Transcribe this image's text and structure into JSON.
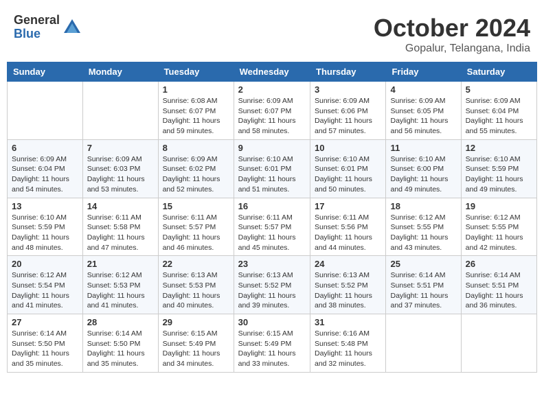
{
  "logo": {
    "general": "General",
    "blue": "Blue"
  },
  "header": {
    "month": "October 2024",
    "location": "Gopalur, Telangana, India"
  },
  "weekdays": [
    "Sunday",
    "Monday",
    "Tuesday",
    "Wednesday",
    "Thursday",
    "Friday",
    "Saturday"
  ],
  "weeks": [
    [
      {
        "day": "",
        "sunrise": "",
        "sunset": "",
        "daylight": ""
      },
      {
        "day": "",
        "sunrise": "",
        "sunset": "",
        "daylight": ""
      },
      {
        "day": "1",
        "sunrise": "Sunrise: 6:08 AM",
        "sunset": "Sunset: 6:07 PM",
        "daylight": "Daylight: 11 hours and 59 minutes."
      },
      {
        "day": "2",
        "sunrise": "Sunrise: 6:09 AM",
        "sunset": "Sunset: 6:07 PM",
        "daylight": "Daylight: 11 hours and 58 minutes."
      },
      {
        "day": "3",
        "sunrise": "Sunrise: 6:09 AM",
        "sunset": "Sunset: 6:06 PM",
        "daylight": "Daylight: 11 hours and 57 minutes."
      },
      {
        "day": "4",
        "sunrise": "Sunrise: 6:09 AM",
        "sunset": "Sunset: 6:05 PM",
        "daylight": "Daylight: 11 hours and 56 minutes."
      },
      {
        "day": "5",
        "sunrise": "Sunrise: 6:09 AM",
        "sunset": "Sunset: 6:04 PM",
        "daylight": "Daylight: 11 hours and 55 minutes."
      }
    ],
    [
      {
        "day": "6",
        "sunrise": "Sunrise: 6:09 AM",
        "sunset": "Sunset: 6:04 PM",
        "daylight": "Daylight: 11 hours and 54 minutes."
      },
      {
        "day": "7",
        "sunrise": "Sunrise: 6:09 AM",
        "sunset": "Sunset: 6:03 PM",
        "daylight": "Daylight: 11 hours and 53 minutes."
      },
      {
        "day": "8",
        "sunrise": "Sunrise: 6:09 AM",
        "sunset": "Sunset: 6:02 PM",
        "daylight": "Daylight: 11 hours and 52 minutes."
      },
      {
        "day": "9",
        "sunrise": "Sunrise: 6:10 AM",
        "sunset": "Sunset: 6:01 PM",
        "daylight": "Daylight: 11 hours and 51 minutes."
      },
      {
        "day": "10",
        "sunrise": "Sunrise: 6:10 AM",
        "sunset": "Sunset: 6:01 PM",
        "daylight": "Daylight: 11 hours and 50 minutes."
      },
      {
        "day": "11",
        "sunrise": "Sunrise: 6:10 AM",
        "sunset": "Sunset: 6:00 PM",
        "daylight": "Daylight: 11 hours and 49 minutes."
      },
      {
        "day": "12",
        "sunrise": "Sunrise: 6:10 AM",
        "sunset": "Sunset: 5:59 PM",
        "daylight": "Daylight: 11 hours and 49 minutes."
      }
    ],
    [
      {
        "day": "13",
        "sunrise": "Sunrise: 6:10 AM",
        "sunset": "Sunset: 5:59 PM",
        "daylight": "Daylight: 11 hours and 48 minutes."
      },
      {
        "day": "14",
        "sunrise": "Sunrise: 6:11 AM",
        "sunset": "Sunset: 5:58 PM",
        "daylight": "Daylight: 11 hours and 47 minutes."
      },
      {
        "day": "15",
        "sunrise": "Sunrise: 6:11 AM",
        "sunset": "Sunset: 5:57 PM",
        "daylight": "Daylight: 11 hours and 46 minutes."
      },
      {
        "day": "16",
        "sunrise": "Sunrise: 6:11 AM",
        "sunset": "Sunset: 5:57 PM",
        "daylight": "Daylight: 11 hours and 45 minutes."
      },
      {
        "day": "17",
        "sunrise": "Sunrise: 6:11 AM",
        "sunset": "Sunset: 5:56 PM",
        "daylight": "Daylight: 11 hours and 44 minutes."
      },
      {
        "day": "18",
        "sunrise": "Sunrise: 6:12 AM",
        "sunset": "Sunset: 5:55 PM",
        "daylight": "Daylight: 11 hours and 43 minutes."
      },
      {
        "day": "19",
        "sunrise": "Sunrise: 6:12 AM",
        "sunset": "Sunset: 5:55 PM",
        "daylight": "Daylight: 11 hours and 42 minutes."
      }
    ],
    [
      {
        "day": "20",
        "sunrise": "Sunrise: 6:12 AM",
        "sunset": "Sunset: 5:54 PM",
        "daylight": "Daylight: 11 hours and 41 minutes."
      },
      {
        "day": "21",
        "sunrise": "Sunrise: 6:12 AM",
        "sunset": "Sunset: 5:53 PM",
        "daylight": "Daylight: 11 hours and 41 minutes."
      },
      {
        "day": "22",
        "sunrise": "Sunrise: 6:13 AM",
        "sunset": "Sunset: 5:53 PM",
        "daylight": "Daylight: 11 hours and 40 minutes."
      },
      {
        "day": "23",
        "sunrise": "Sunrise: 6:13 AM",
        "sunset": "Sunset: 5:52 PM",
        "daylight": "Daylight: 11 hours and 39 minutes."
      },
      {
        "day": "24",
        "sunrise": "Sunrise: 6:13 AM",
        "sunset": "Sunset: 5:52 PM",
        "daylight": "Daylight: 11 hours and 38 minutes."
      },
      {
        "day": "25",
        "sunrise": "Sunrise: 6:14 AM",
        "sunset": "Sunset: 5:51 PM",
        "daylight": "Daylight: 11 hours and 37 minutes."
      },
      {
        "day": "26",
        "sunrise": "Sunrise: 6:14 AM",
        "sunset": "Sunset: 5:51 PM",
        "daylight": "Daylight: 11 hours and 36 minutes."
      }
    ],
    [
      {
        "day": "27",
        "sunrise": "Sunrise: 6:14 AM",
        "sunset": "Sunset: 5:50 PM",
        "daylight": "Daylight: 11 hours and 35 minutes."
      },
      {
        "day": "28",
        "sunrise": "Sunrise: 6:14 AM",
        "sunset": "Sunset: 5:50 PM",
        "daylight": "Daylight: 11 hours and 35 minutes."
      },
      {
        "day": "29",
        "sunrise": "Sunrise: 6:15 AM",
        "sunset": "Sunset: 5:49 PM",
        "daylight": "Daylight: 11 hours and 34 minutes."
      },
      {
        "day": "30",
        "sunrise": "Sunrise: 6:15 AM",
        "sunset": "Sunset: 5:49 PM",
        "daylight": "Daylight: 11 hours and 33 minutes."
      },
      {
        "day": "31",
        "sunrise": "Sunrise: 6:16 AM",
        "sunset": "Sunset: 5:48 PM",
        "daylight": "Daylight: 11 hours and 32 minutes."
      },
      {
        "day": "",
        "sunrise": "",
        "sunset": "",
        "daylight": ""
      },
      {
        "day": "",
        "sunrise": "",
        "sunset": "",
        "daylight": ""
      }
    ]
  ]
}
